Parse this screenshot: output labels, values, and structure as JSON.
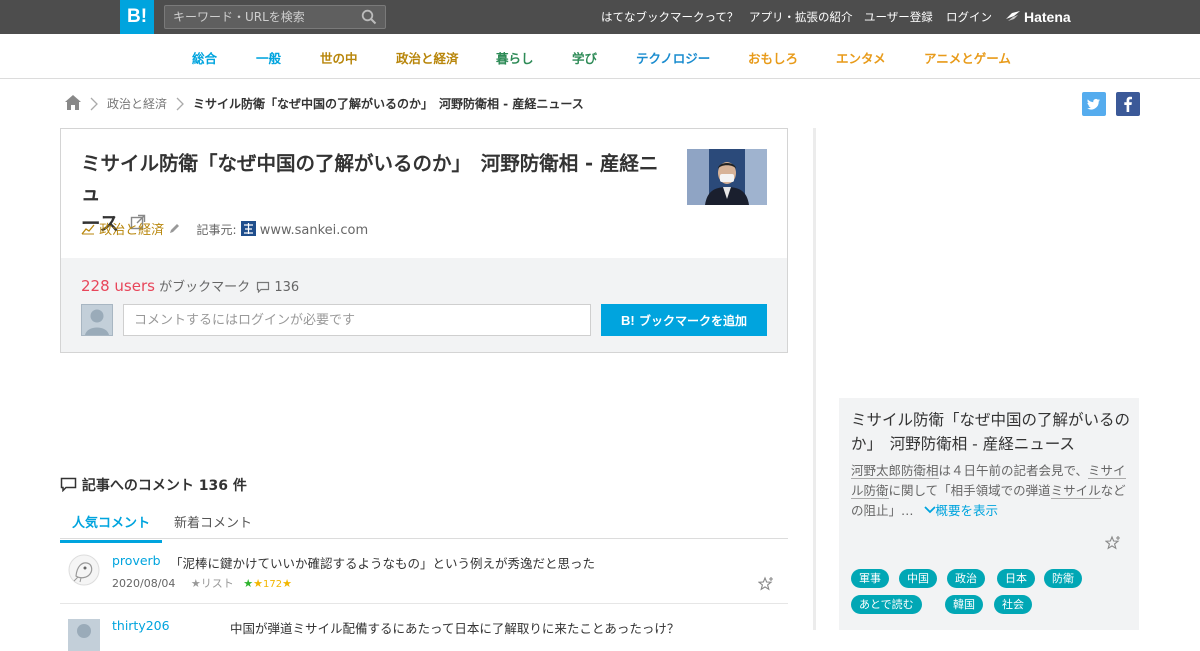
{
  "header": {
    "logo_text": "B!",
    "search_placeholder": "キーワード・URLを検索",
    "nav": [
      "はてなブックマークって？",
      "アプリ・拡張の紹介",
      "ユーザー登録",
      "ログイン"
    ],
    "brand": "Hatena"
  },
  "categories": [
    {
      "label": "総合",
      "color": "#00a4de"
    },
    {
      "label": "一般",
      "color": "#00a4de"
    },
    {
      "label": "世の中",
      "color": "#b8860b"
    },
    {
      "label": "政治と経済",
      "color": "#b8860b"
    },
    {
      "label": "暮らし",
      "color": "#2e8b57"
    },
    {
      "label": "学び",
      "color": "#2e8b57"
    },
    {
      "label": "テクノロジー",
      "color": "#1a8ccf"
    },
    {
      "label": "おもしろ",
      "color": "#e89b1a"
    },
    {
      "label": "エンタメ",
      "color": "#e89b1a"
    },
    {
      "label": "アニメとゲーム",
      "color": "#e89b1a"
    }
  ],
  "breadcrumb": {
    "category": "政治と経済",
    "current": "ミサイル防衛「なぜ中国の了解がいるのか」　河野防衛相 - 産経ニュース"
  },
  "entry": {
    "title_line1": "ミサイル防衛「なぜ中国の了解がいるのか」　河野防衛相 - 産経ニュ",
    "title_line2": "ース",
    "category": "政治と経済",
    "source_label": "記事元:",
    "source_domain": "www.sankei.com",
    "users_count": "228 users",
    "users_suffix": "がブックマーク",
    "comment_count": "136",
    "comment_placeholder": "コメントするにはログインが必要です",
    "add_button": "ブックマークを追加"
  },
  "comments_section": {
    "heading": "記事へのコメント 136 件",
    "tabs": [
      "人気コメント",
      "新着コメント"
    ],
    "items": [
      {
        "user": "proverb",
        "text": "「泥棒に鍵かけていいか確認するようなもの」という例えが秀逸だと思った",
        "date": "2020/08/04",
        "list_label": "リスト",
        "stars": "172"
      },
      {
        "user": "thirty206",
        "text": "中国が弾道ミサイル配備するにあたって日本に了解取りに来たことあったっけ？"
      }
    ]
  },
  "sidebar": {
    "title": "ミサイル防衛「なぜ中国の了解がいるのか」　河野防衛相 - 産経ニュース",
    "desc_parts": [
      "河野太郎防衛相",
      "は４日午前の記者会見で、",
      "ミサイル防衛",
      "に関して「相手領域での弾道",
      "ミサイル",
      "などの阻止」…"
    ],
    "expand_label": "概要を表示",
    "tags": [
      "軍事",
      "中国",
      "政治",
      "日本",
      "防衛",
      "あとで読む",
      "韓国",
      "社会"
    ]
  },
  "colors": {
    "accent": "#00a4de",
    "users": "#e8465a",
    "tag": "#01a7b5",
    "topbar": "#4d4d4d"
  }
}
